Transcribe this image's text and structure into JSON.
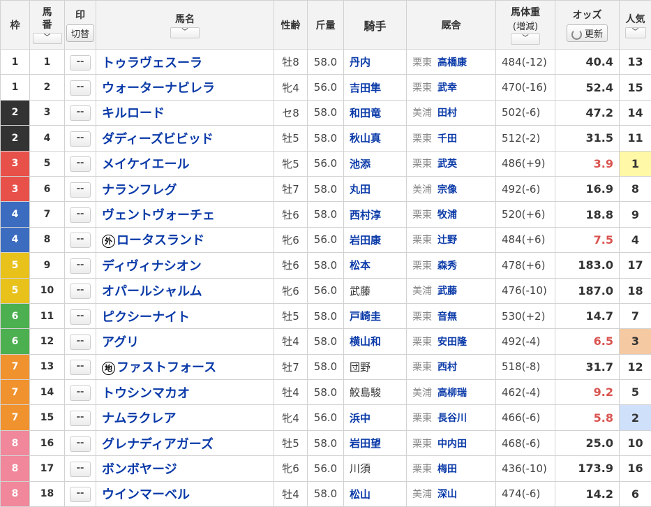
{
  "headers": {
    "waku": "枠",
    "umaban": "馬\n番",
    "mark": "印",
    "mark_toggle": "切替",
    "horse": "馬名",
    "sexage": "性齢",
    "weight": "斤量",
    "jockey": "騎手",
    "stable": "厩舎",
    "bodyweight": "馬体重",
    "bodyweight_sub": "(増減)",
    "odds": "オッズ",
    "refresh": "更新",
    "popularity": "人気",
    "sort_glyph": "﹀"
  },
  "mark_placeholder": "--",
  "rows": [
    {
      "waku": "1",
      "frame": 1,
      "num": "1",
      "horse": "トゥラヴェスーラ",
      "badge": "",
      "sexage": "牡8",
      "weight": "58.0",
      "jockey": "丹内",
      "region": "栗東",
      "trainer": "高橋康",
      "bw": "484(-12)",
      "odds": "40.4",
      "hot": false,
      "pop": "13",
      "pophl": ""
    },
    {
      "waku": "1",
      "frame": 1,
      "num": "2",
      "horse": "ウォーターナビレラ",
      "badge": "",
      "sexage": "牝4",
      "weight": "56.0",
      "jockey": "吉田隼",
      "region": "栗東",
      "trainer": "武幸",
      "bw": "470(-16)",
      "odds": "52.4",
      "hot": false,
      "pop": "15",
      "pophl": ""
    },
    {
      "waku": "2",
      "frame": 2,
      "num": "3",
      "horse": "キルロード",
      "badge": "",
      "sexage": "セ8",
      "weight": "58.0",
      "jockey": "和田竜",
      "region": "美浦",
      "trainer": "田村",
      "bw": "502(-6)",
      "odds": "47.2",
      "hot": false,
      "pop": "14",
      "pophl": ""
    },
    {
      "waku": "2",
      "frame": 2,
      "num": "4",
      "horse": "ダディーズビビッド",
      "badge": "",
      "sexage": "牡5",
      "weight": "58.0",
      "jockey": "秋山真",
      "region": "栗東",
      "trainer": "千田",
      "bw": "512(-2)",
      "odds": "31.5",
      "hot": false,
      "pop": "11",
      "pophl": ""
    },
    {
      "waku": "3",
      "frame": 3,
      "num": "5",
      "horse": "メイケイエール",
      "badge": "",
      "sexage": "牝5",
      "weight": "56.0",
      "jockey": "池添",
      "region": "栗東",
      "trainer": "武英",
      "bw": "486(+9)",
      "odds": "3.9",
      "hot": true,
      "pop": "1",
      "pophl": "pop1"
    },
    {
      "waku": "3",
      "frame": 3,
      "num": "6",
      "horse": "ナランフレグ",
      "badge": "",
      "sexage": "牡7",
      "weight": "58.0",
      "jockey": "丸田",
      "region": "美浦",
      "trainer": "宗像",
      "bw": "492(-6)",
      "odds": "16.9",
      "hot": false,
      "pop": "8",
      "pophl": ""
    },
    {
      "waku": "4",
      "frame": 4,
      "num": "7",
      "horse": "ヴェントヴォーチェ",
      "badge": "",
      "sexage": "牡6",
      "weight": "58.0",
      "jockey": "西村淳",
      "region": "栗東",
      "trainer": "牧浦",
      "bw": "520(+6)",
      "odds": "18.8",
      "hot": false,
      "pop": "9",
      "pophl": ""
    },
    {
      "waku": "4",
      "frame": 4,
      "num": "8",
      "horse": "ロータスランド",
      "badge": "外",
      "sexage": "牝6",
      "weight": "56.0",
      "jockey": "岩田康",
      "region": "栗東",
      "trainer": "辻野",
      "bw": "484(+6)",
      "odds": "7.5",
      "hot": true,
      "pop": "4",
      "pophl": ""
    },
    {
      "waku": "5",
      "frame": 5,
      "num": "9",
      "horse": "ディヴィナシオン",
      "badge": "",
      "sexage": "牡6",
      "weight": "58.0",
      "jockey": "松本",
      "region": "栗東",
      "trainer": "森秀",
      "bw": "478(+6)",
      "odds": "183.0",
      "hot": false,
      "pop": "17",
      "pophl": ""
    },
    {
      "waku": "5",
      "frame": 5,
      "num": "10",
      "horse": "オパールシャルム",
      "badge": "",
      "sexage": "牝6",
      "weight": "56.0",
      "jockey": "武藤",
      "region": "美浦",
      "trainer": "武藤",
      "bw": "476(-10)",
      "odds": "187.0",
      "hot": false,
      "pop": "18",
      "pophl": "",
      "plain": true
    },
    {
      "waku": "6",
      "frame": 6,
      "num": "11",
      "horse": "ピクシーナイト",
      "badge": "",
      "sexage": "牡5",
      "weight": "58.0",
      "jockey": "戸崎圭",
      "region": "栗東",
      "trainer": "音無",
      "bw": "530(+2)",
      "odds": "14.7",
      "hot": false,
      "pop": "7",
      "pophl": ""
    },
    {
      "waku": "6",
      "frame": 6,
      "num": "12",
      "horse": "アグリ",
      "badge": "",
      "sexage": "牡4",
      "weight": "58.0",
      "jockey": "横山和",
      "region": "栗東",
      "trainer": "安田隆",
      "bw": "492(-4)",
      "odds": "6.5",
      "hot": true,
      "pop": "3",
      "pophl": "pop3"
    },
    {
      "waku": "7",
      "frame": 7,
      "num": "13",
      "horse": "ファストフォース",
      "badge": "地",
      "sexage": "牡7",
      "weight": "58.0",
      "jockey": "団野",
      "region": "栗東",
      "trainer": "西村",
      "bw": "518(-8)",
      "odds": "31.7",
      "hot": false,
      "pop": "12",
      "pophl": "",
      "plain": true
    },
    {
      "waku": "7",
      "frame": 7,
      "num": "14",
      "horse": "トウシンマカオ",
      "badge": "",
      "sexage": "牡4",
      "weight": "58.0",
      "jockey": "鮫島駿",
      "region": "美浦",
      "trainer": "高柳瑞",
      "bw": "462(-4)",
      "odds": "9.2",
      "hot": true,
      "pop": "5",
      "pophl": "",
      "plain": true
    },
    {
      "waku": "7",
      "frame": 7,
      "num": "15",
      "horse": "ナムラクレア",
      "badge": "",
      "sexage": "牝4",
      "weight": "56.0",
      "jockey": "浜中",
      "region": "栗東",
      "trainer": "長谷川",
      "bw": "466(-6)",
      "odds": "5.8",
      "hot": true,
      "pop": "2",
      "pophl": "pop2"
    },
    {
      "waku": "8",
      "frame": 8,
      "num": "16",
      "horse": "グレナディアガーズ",
      "badge": "",
      "sexage": "牡5",
      "weight": "58.0",
      "jockey": "岩田望",
      "region": "栗東",
      "trainer": "中内田",
      "bw": "468(-6)",
      "odds": "25.0",
      "hot": false,
      "pop": "10",
      "pophl": ""
    },
    {
      "waku": "8",
      "frame": 8,
      "num": "17",
      "horse": "ボンボヤージ",
      "badge": "",
      "sexage": "牝6",
      "weight": "56.0",
      "jockey": "川須",
      "region": "栗東",
      "trainer": "梅田",
      "bw": "436(-10)",
      "odds": "173.9",
      "hot": false,
      "pop": "16",
      "pophl": "",
      "plain": true
    },
    {
      "waku": "8",
      "frame": 8,
      "num": "18",
      "horse": "ウインマーベル",
      "badge": "",
      "sexage": "牡4",
      "weight": "58.0",
      "jockey": "松山",
      "region": "美浦",
      "trainer": "深山",
      "bw": "474(-6)",
      "odds": "14.2",
      "hot": false,
      "pop": "6",
      "pophl": ""
    }
  ]
}
